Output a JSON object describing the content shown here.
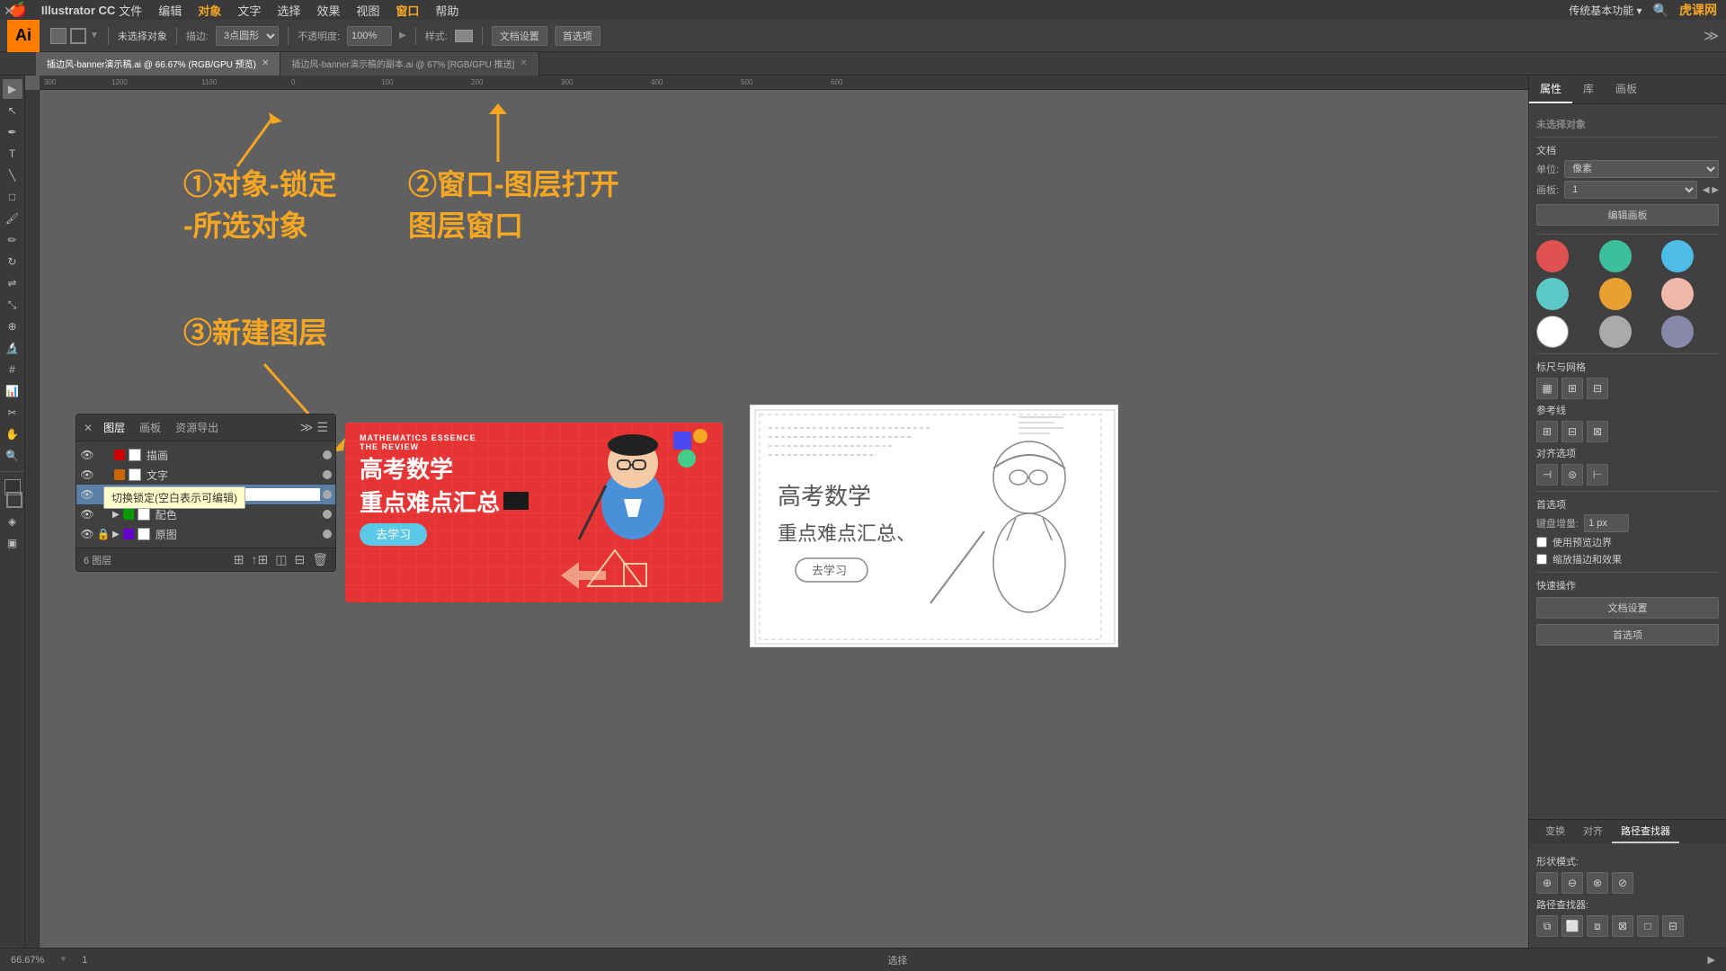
{
  "app": {
    "name": "Illustrator CC",
    "logo": "Ai"
  },
  "menubar": {
    "apple": "🍎",
    "items": [
      "Illustrator CC",
      "文件",
      "编辑",
      "对象",
      "文字",
      "选择",
      "效果",
      "视图",
      "窗口",
      "帮助"
    ]
  },
  "toolbar": {
    "no_selection": "未选择对象",
    "stroke_label": "描边:",
    "stroke_value": "3点圆形",
    "opacity_label": "不透明度:",
    "opacity_value": "100%",
    "style_label": "样式:",
    "doc_settings": "文档设置",
    "preferences": "首选项"
  },
  "tabs": [
    {
      "label": "插边风-banner演示稿.ai @ 66.67% (RGB/GPU 预览)",
      "active": true
    },
    {
      "label": "插边风-banner演示稿的副本.ai @ 67% [RGB/GPU 推送]",
      "active": false
    }
  ],
  "annotations": [
    {
      "id": "ann1",
      "text": "①对象-锁定\n-所选对象"
    },
    {
      "id": "ann2",
      "text": "②窗口-图层打开\n图层窗口"
    },
    {
      "id": "ann3",
      "text": "③新建图层"
    }
  ],
  "layers_panel": {
    "title": "图层",
    "tabs": [
      "图层",
      "画板",
      "资源导出"
    ],
    "layers": [
      {
        "name": "描画",
        "visible": true,
        "locked": false,
        "color": "#cc0000",
        "active": false
      },
      {
        "name": "文字",
        "visible": true,
        "locked": false,
        "color": "#cc6600",
        "active": false
      },
      {
        "name": "",
        "visible": true,
        "locked": false,
        "color": "#0066cc",
        "active": true,
        "editing": true
      },
      {
        "name": "配色",
        "visible": true,
        "locked": false,
        "color": "#009900",
        "active": false,
        "expanded": true
      },
      {
        "name": "原图",
        "visible": true,
        "locked": true,
        "color": "#6600cc",
        "active": false,
        "expanded": true
      }
    ],
    "footer": "6 图层"
  },
  "tooltip": "切换锁定(空白表示可编辑)",
  "right_panel": {
    "tabs": [
      "属性",
      "库",
      "画板"
    ],
    "active_tab": "属性",
    "no_selection": "未选择对象",
    "document_section": "文档",
    "unit_label": "单位:",
    "unit_value": "像素",
    "artboard_label": "画板:",
    "artboard_value": "1",
    "edit_artboard_btn": "编辑画板",
    "grid_section": "标尺与网格",
    "guides_section": "参考线",
    "align_section": "对齐选项",
    "preferences_section": "首选项",
    "keyboard_increment_label": "键盘增量:",
    "keyboard_increment_value": "1 px",
    "use_preview_bounds": "使用预览边界",
    "scale_corners": "缩放描边和效果",
    "quick_actions": "快速操作",
    "doc_settings_btn": "文档设置",
    "preferences_btn": "首选项",
    "bottom_tabs": [
      "变换",
      "对齐",
      "路径查找器"
    ],
    "active_bottom_tab": "路径查找器",
    "shape_modes_label": "形状模式:",
    "pathfinder_label": "路径查找器:"
  },
  "colors": {
    "swatch1": "#e05252",
    "swatch2": "#3dbf9c",
    "swatch3": "#4dbde8",
    "swatch4": "#5dc8c8",
    "swatch5": "#e8a030",
    "swatch6": "#f0b8a8",
    "swatch7": "#ffffff",
    "swatch8": "#aaaaaa",
    "swatch9": "#8888aa"
  },
  "status_bar": {
    "zoom": "66.67%",
    "artboard": "1",
    "tool": "选择"
  },
  "site_logo": "虎课网",
  "banner_red": {
    "tag1": "MATHEMATICS ESSENCE",
    "tag2": "THE REVIEW",
    "title_line1": "高考数学",
    "title_line2": "重点难点汇总",
    "btn": "去学习"
  }
}
